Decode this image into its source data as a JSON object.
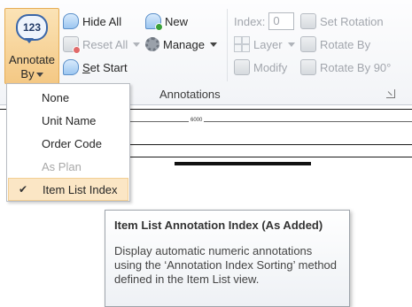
{
  "ribbon": {
    "annotate_button": {
      "line1": "Annotate",
      "line2": "By",
      "icon_text": "123"
    },
    "hide_all": "Hide All",
    "reset_all": "Reset All",
    "set_start": "Set Start",
    "new": "New",
    "manage": "Manage",
    "index_label": "Index:",
    "index_value": "0",
    "layer": "Layer",
    "modify": "Modify",
    "set_rotation": "Set Rotation",
    "rotate_by": "Rotate By",
    "rotate_by_90": "Rotate By 90°",
    "group_label": "Annotations"
  },
  "canvas": {
    "dimension_label": "6000"
  },
  "menu": {
    "items": [
      {
        "label": "None",
        "enabled": true,
        "checked": false
      },
      {
        "label": "Unit Name",
        "enabled": true,
        "checked": false
      },
      {
        "label": "Order Code",
        "enabled": true,
        "checked": false
      },
      {
        "label": "As Plan",
        "enabled": false,
        "checked": false
      },
      {
        "label": "Item List Index",
        "enabled": true,
        "checked": true
      }
    ],
    "check_glyph": "✔"
  },
  "tooltip": {
    "title": "Item List Annotation Index (As Added)",
    "body": "Display automatic numeric annotations using the ‘Annotation Index Sorting’ method defined in the Item List view."
  },
  "colors": {
    "accent_button": "#f4c884",
    "selected_item": "#fbe6c5",
    "disabled_text": "#a2a6ad"
  }
}
